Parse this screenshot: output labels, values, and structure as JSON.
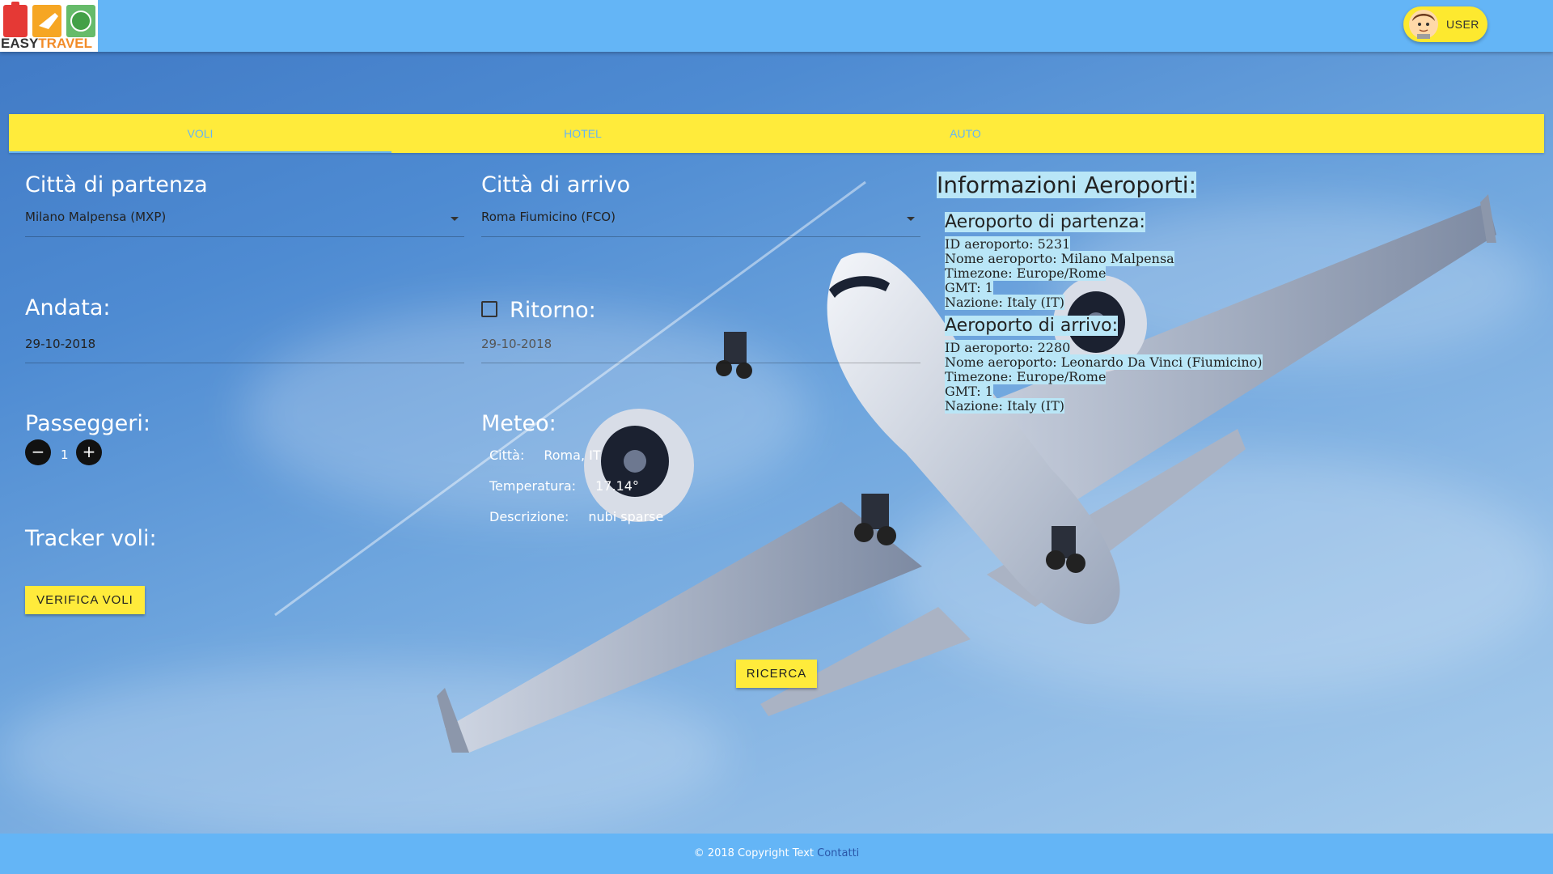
{
  "header": {
    "logo_text_a": "EASY",
    "logo_text_b": "TRAVEL",
    "user_label": "USER"
  },
  "tabs": [
    {
      "label": "VOLI",
      "active": true
    },
    {
      "label": "HOTEL",
      "active": false
    },
    {
      "label": "AUTO",
      "active": false
    }
  ],
  "form": {
    "departure_label": "Città di partenza",
    "departure_value": "Milano Malpensa (MXP)",
    "arrival_label": "Città di arrivo",
    "arrival_value": "Roma Fiumicino (FCO)",
    "outbound_label": "Andata:",
    "outbound_date": "29-10-2018",
    "return_label": "Ritorno:",
    "return_date": "29-10-2018",
    "return_checked": false,
    "passengers_label": "Passeggeri:",
    "passengers_minus": "−",
    "passengers_plus": "+",
    "passengers_count": "1",
    "tracker_label": "Tracker voli:",
    "verify_button": "VERIFICA VOLI",
    "search_button": "RICERCA"
  },
  "meteo": {
    "title": "Meteo:",
    "city_label": "Città:",
    "city_value": "Roma, IT",
    "temp_label": "Temperatura:",
    "temp_value": "17.14°",
    "desc_label": "Descrizione:",
    "desc_value": "nubi sparse"
  },
  "info": {
    "title": "Informazioni Aeroporti:",
    "departure": {
      "title": "Aeroporto di partenza:",
      "lines": [
        "ID aeroporto: 5231",
        "Nome aeroporto: Milano Malpensa",
        "Timezone: Europe/Rome",
        "GMT: 1",
        "Nazione: Italy (IT)"
      ]
    },
    "arrival": {
      "title": "Aeroporto di arrivo:",
      "lines": [
        "ID aeroporto: 2280",
        "Nome aeroporto: Leonardo Da Vinci (Fiumicino)",
        "Timezone: Europe/Rome",
        "GMT: 1",
        "Nazione: Italy (IT)"
      ]
    }
  },
  "footer": {
    "copyright": "© 2018 Copyright Text",
    "link": "Contatti"
  },
  "colors": {
    "header_bg": "#64b5f6",
    "accent_yellow": "#ffeb3b",
    "info_highlight": "#b9e6f7"
  }
}
